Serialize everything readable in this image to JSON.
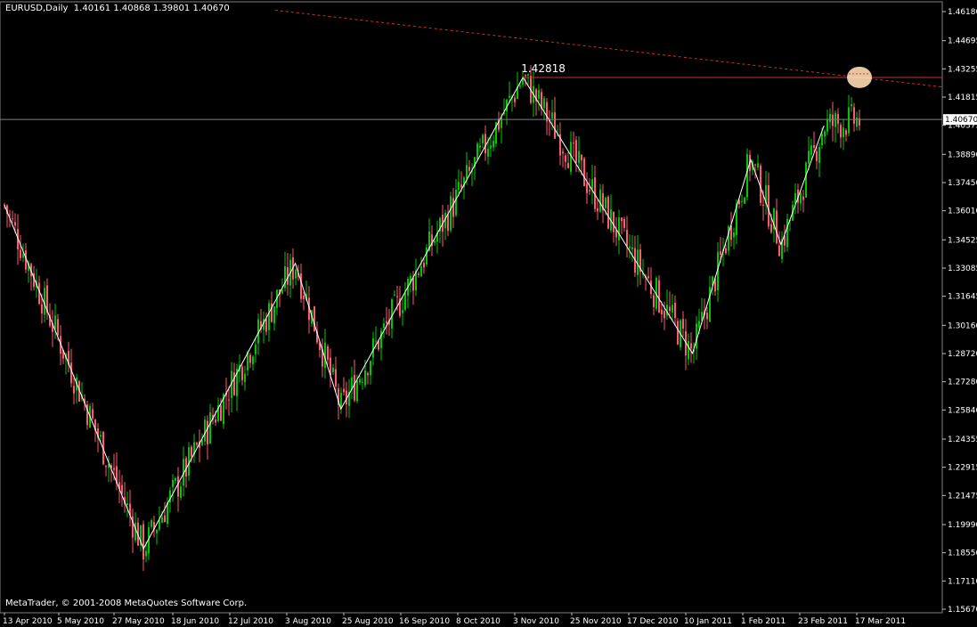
{
  "header": {
    "symbol": "EURUSD,Daily",
    "open": "1.40161",
    "high": "1.40868",
    "low": "1.39801",
    "close": "1.40670"
  },
  "footer": {
    "credit": "MetaTrader, © 2001-2008 MetaQuotes Software Corp."
  },
  "colors": {
    "background": "#000000",
    "bull": "#00c800",
    "bear": "#ff5a6e",
    "grid": "#3a3a3a",
    "zigzag": "#ffffff",
    "level": "#c83232",
    "trend": "#c83232",
    "marker": "#ffdcb4"
  },
  "chart_data": {
    "type": "candlestick",
    "y_axis": {
      "ticks": [
        "1.46180",
        "1.44695",
        "1.43255",
        "1.41815",
        "1.40375",
        "1.38890",
        "1.37450",
        "1.36010",
        "1.34525",
        "1.33085",
        "1.31645",
        "1.30160",
        "1.28720",
        "1.27280",
        "1.25840",
        "1.24355",
        "1.22915",
        "1.21475",
        "1.19990",
        "1.18550",
        "1.17110",
        "1.15670"
      ],
      "range": [
        1.1567,
        1.4618
      ]
    },
    "x_axis": {
      "ticks": [
        "13 Apr 2010",
        "5 May 2010",
        "27 May 2010",
        "18 Jun 2010",
        "12 Jul 2010",
        "3 Aug 2010",
        "25 Aug 2010",
        "16 Sep 2010",
        "8 Oct 2010",
        "3 Nov 2010",
        "25 Nov 2010",
        "17 Dec 2010",
        "10 Jan 2011",
        "1 Feb 2011",
        "23 Feb 2011",
        "17 Mar 2011"
      ]
    },
    "current_price": "1.40670",
    "peak_label": "1.42818",
    "level_price": 1.42818,
    "zigzag": [
      {
        "date": "2010-04-13",
        "price": 1.363
      },
      {
        "date": "2010-06-07",
        "price": 1.1876
      },
      {
        "date": "2010-08-06",
        "price": 1.3333
      },
      {
        "date": "2010-08-24",
        "price": 1.2589
      },
      {
        "date": "2010-11-04",
        "price": 1.4282
      },
      {
        "date": "2011-01-10",
        "price": 1.2873
      },
      {
        "date": "2011-02-02",
        "price": 1.3862
      },
      {
        "date": "2011-02-14",
        "price": 1.3429
      },
      {
        "date": "2011-03-03",
        "price": 1.4036
      }
    ],
    "trendline": [
      {
        "date": "2010-07-29",
        "price": 1.4625
      },
      {
        "date": "2011-03-30",
        "price": 1.4233
      }
    ],
    "marker": {
      "date": "2011-03-17",
      "price": 1.4282
    }
  }
}
